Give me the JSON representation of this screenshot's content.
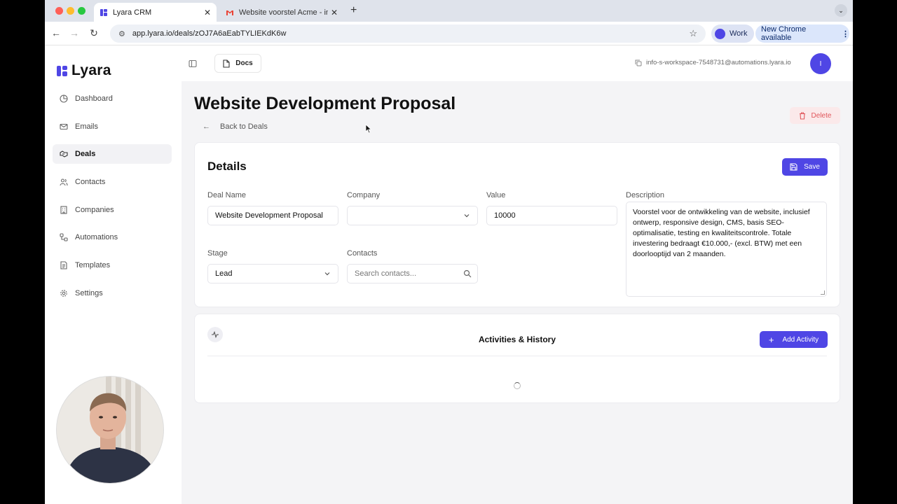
{
  "browser": {
    "tabs": [
      {
        "title": "Lyara CRM",
        "active": true
      },
      {
        "title": "Website voorstel Acme - info-s",
        "active": false
      }
    ],
    "url": "app.lyara.io/deals/zOJ7A6aEabTYLIEKdK6w",
    "profile_label": "Work",
    "update_label": "New Chrome available"
  },
  "app": {
    "brand": "Lyara",
    "accent_color": "#4f46e5",
    "nav": [
      {
        "label": "Dashboard",
        "icon": "pie-chart-icon",
        "active": false
      },
      {
        "label": "Emails",
        "icon": "mail-icon",
        "active": false
      },
      {
        "label": "Deals",
        "icon": "handshake-icon",
        "active": true
      },
      {
        "label": "Contacts",
        "icon": "users-icon",
        "active": false
      },
      {
        "label": "Companies",
        "icon": "building-icon",
        "active": false
      },
      {
        "label": "Automations",
        "icon": "workflow-icon",
        "active": false
      },
      {
        "label": "Templates",
        "icon": "file-text-icon",
        "active": false
      },
      {
        "label": "Settings",
        "icon": "gear-icon",
        "active": false
      }
    ],
    "topbar": {
      "docs_label": "Docs",
      "email": "info-s-workspace-7548731@automations.lyara.io",
      "avatar_initial": "I"
    }
  },
  "deal": {
    "title": "Website Development Proposal",
    "back_label": "Back to Deals",
    "delete_label": "Delete",
    "details_heading": "Details",
    "save_label": "Save",
    "fields": {
      "deal_name_label": "Deal Name",
      "deal_name_value": "Website Development Proposal",
      "company_label": "Company",
      "company_value": "",
      "value_label": "Value",
      "value_value": "10000",
      "description_label": "Description",
      "description_value": "Voorstel voor de ontwikkeling van de website, inclusief ontwerp, responsive design, CMS, basis SEO-optimalisatie, testing en kwaliteitscontrole. Totale investering bedraagt €10.000,- (excl. BTW) met een doorlooptijd van 2 maanden.",
      "stage_label": "Stage",
      "stage_value": "Lead",
      "contacts_label": "Contacts",
      "contacts_placeholder": "Search contacts..."
    },
    "activities": {
      "heading": "Activities & History",
      "add_label": "Add Activity"
    }
  }
}
